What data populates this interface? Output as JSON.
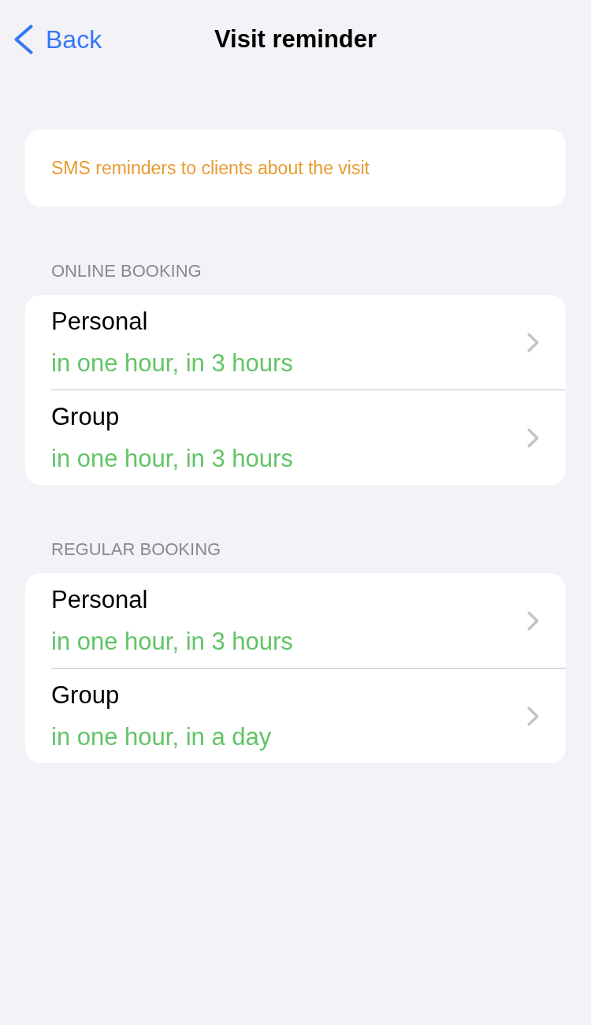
{
  "nav": {
    "back": "Back",
    "title": "Visit reminder"
  },
  "info": {
    "text": "SMS reminders to clients about the visit"
  },
  "sections": [
    {
      "header": "ONLINE BOOKING",
      "rows": [
        {
          "title": "Personal",
          "value": "in one hour, in 3 hours"
        },
        {
          "title": "Group",
          "value": "in one hour, in 3 hours"
        }
      ]
    },
    {
      "header": "REGULAR BOOKING",
      "rows": [
        {
          "title": "Personal",
          "value": "in one hour, in 3 hours"
        },
        {
          "title": "Group",
          "value": "in one hour, in a day"
        }
      ]
    }
  ]
}
